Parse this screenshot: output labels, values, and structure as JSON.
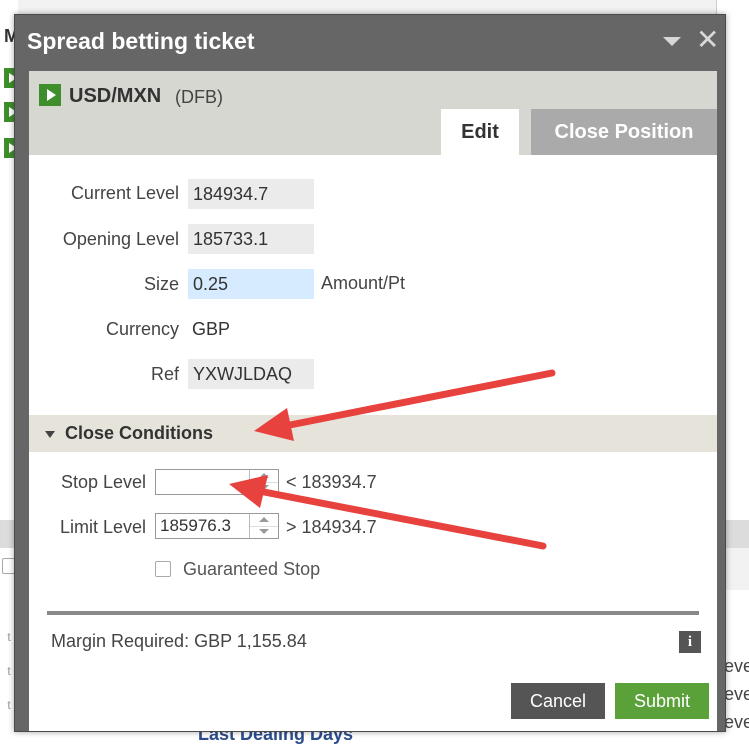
{
  "background": {
    "left_heading": "M",
    "row_marker": "t",
    "right_text": [
      "eve",
      "eve",
      "eve"
    ],
    "link_text": "Last Dealing Days"
  },
  "dialog": {
    "title": "Spread betting ticket",
    "instrument": {
      "name": "USD/MXN",
      "type": "(DFB)"
    },
    "tabs": [
      {
        "label": "Edit",
        "active": true
      },
      {
        "label": "Close Position",
        "active": false
      }
    ],
    "fields": {
      "current_level": {
        "label": "Current Level",
        "value": "184934.7"
      },
      "opening_level": {
        "label": "Opening Level",
        "value": "185733.1"
      },
      "size": {
        "label": "Size",
        "value": "0.25",
        "unit": "Amount/Pt"
      },
      "currency": {
        "label": "Currency",
        "value": "GBP"
      },
      "ref": {
        "label": "Ref",
        "value": "YXWJLDAQ"
      }
    },
    "close_conditions": {
      "title": "Close Conditions",
      "stop_level": {
        "label": "Stop Level",
        "value": "",
        "constraint": "< 183934.7"
      },
      "limit_level": {
        "label": "Limit Level",
        "value": "185976.3",
        "constraint": "> 184934.7"
      },
      "guaranteed_stop": {
        "label": "Guaranteed Stop",
        "checked": false
      }
    },
    "margin": "Margin Required:  GBP 1,155.84",
    "buttons": {
      "cancel": "Cancel",
      "submit": "Submit"
    }
  },
  "colors": {
    "accent_green": "#5aa13a",
    "annotation_red": "#e8423f"
  }
}
